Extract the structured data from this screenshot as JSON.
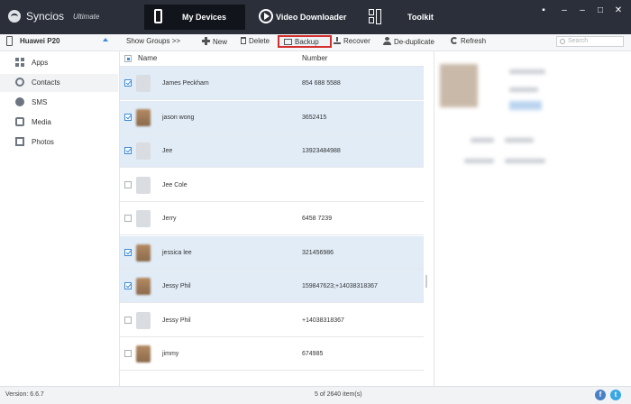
{
  "app": {
    "name": "Syncios",
    "edition": "Ultimate"
  },
  "nav": {
    "my_devices": "My Devices",
    "video_downloader": "Video Downloader",
    "toolkit": "Toolkit"
  },
  "window_controls": {
    "chat": "▪",
    "minimize": "–",
    "maximize": "□",
    "close": "✕"
  },
  "device": {
    "name": "Huawei P20"
  },
  "toolbar": {
    "show_groups": "Show Groups >>",
    "new": "New",
    "delete": "Delete",
    "backup": "Backup",
    "recover": "Recover",
    "dedup": "De-duplicate",
    "refresh": "Refresh",
    "search_placeholder": "Search"
  },
  "sidebar": {
    "items": [
      {
        "label": "Apps",
        "icon": "apps-icon"
      },
      {
        "label": "Contacts",
        "icon": "contacts-icon"
      },
      {
        "label": "SMS",
        "icon": "sms-icon"
      },
      {
        "label": "Media",
        "icon": "media-icon"
      },
      {
        "label": "Photos",
        "icon": "photos-icon"
      }
    ]
  },
  "list": {
    "headers": {
      "name": "Name",
      "number": "Number"
    },
    "rows": [
      {
        "name": "James Peckham",
        "number": "854 688 5588",
        "selected": true,
        "photo": false
      },
      {
        "name": "jason wong",
        "number": "3652415",
        "selected": true,
        "photo": true
      },
      {
        "name": "Jee",
        "number": "13923484988",
        "selected": true,
        "photo": false
      },
      {
        "name": "Jee Cole",
        "number": "",
        "selected": false,
        "photo": false
      },
      {
        "name": "Jerry",
        "number": "6458 7239",
        "selected": false,
        "photo": false
      },
      {
        "name": "jessica lee",
        "number": "321456986",
        "selected": true,
        "photo": true
      },
      {
        "name": "Jessy Phil",
        "number": "159847623;+14038318367",
        "selected": true,
        "photo": true
      },
      {
        "name": "Jessy Phil",
        "number": "+14038318367",
        "selected": false,
        "photo": false
      },
      {
        "name": "jimmy",
        "number": "674985",
        "selected": false,
        "photo": true
      }
    ]
  },
  "status": {
    "version": "Version: 6.6.7",
    "count": "5 of 2640 item(s)"
  },
  "social": {
    "facebook": "f",
    "twitter": "t"
  }
}
